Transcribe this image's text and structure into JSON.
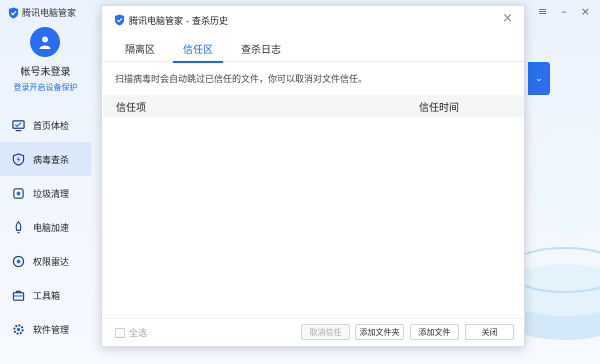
{
  "app": {
    "title": "腾讯电脑管家",
    "user_name": "帐号未登录",
    "login_link": "登录开启设备保护",
    "nav": [
      {
        "label": "首页体检",
        "icon": "monitor-icon"
      },
      {
        "label": "病毒查杀",
        "icon": "lightning-shield-icon"
      },
      {
        "label": "垃圾清理",
        "icon": "broom-icon"
      },
      {
        "label": "电脑加速",
        "icon": "rocket-icon"
      },
      {
        "label": "权限雷达",
        "icon": "radar-icon"
      },
      {
        "label": "工具箱",
        "icon": "toolbox-icon"
      },
      {
        "label": "软件管理",
        "icon": "gear-app-icon"
      }
    ],
    "active_nav": 1
  },
  "dialog": {
    "title": "腾讯电脑管家 - 查杀历史",
    "close": "×",
    "tabs": [
      "隔离区",
      "信任区",
      "查杀日志"
    ],
    "active_tab": 1,
    "notice": "扫描病毒时会自动跳过已信任的文件，你可以取消对文件信任。",
    "columns": [
      "信任项",
      "信任时间"
    ],
    "rows": [],
    "select_all": "全选",
    "buttons": {
      "cancel_trust": "取消信任",
      "add_folder": "添加文件夹",
      "add_file": "添加文件",
      "close": "关闭"
    }
  },
  "colors": {
    "accent": "#1f67e8",
    "brand_blue": "#2a6ef0"
  }
}
